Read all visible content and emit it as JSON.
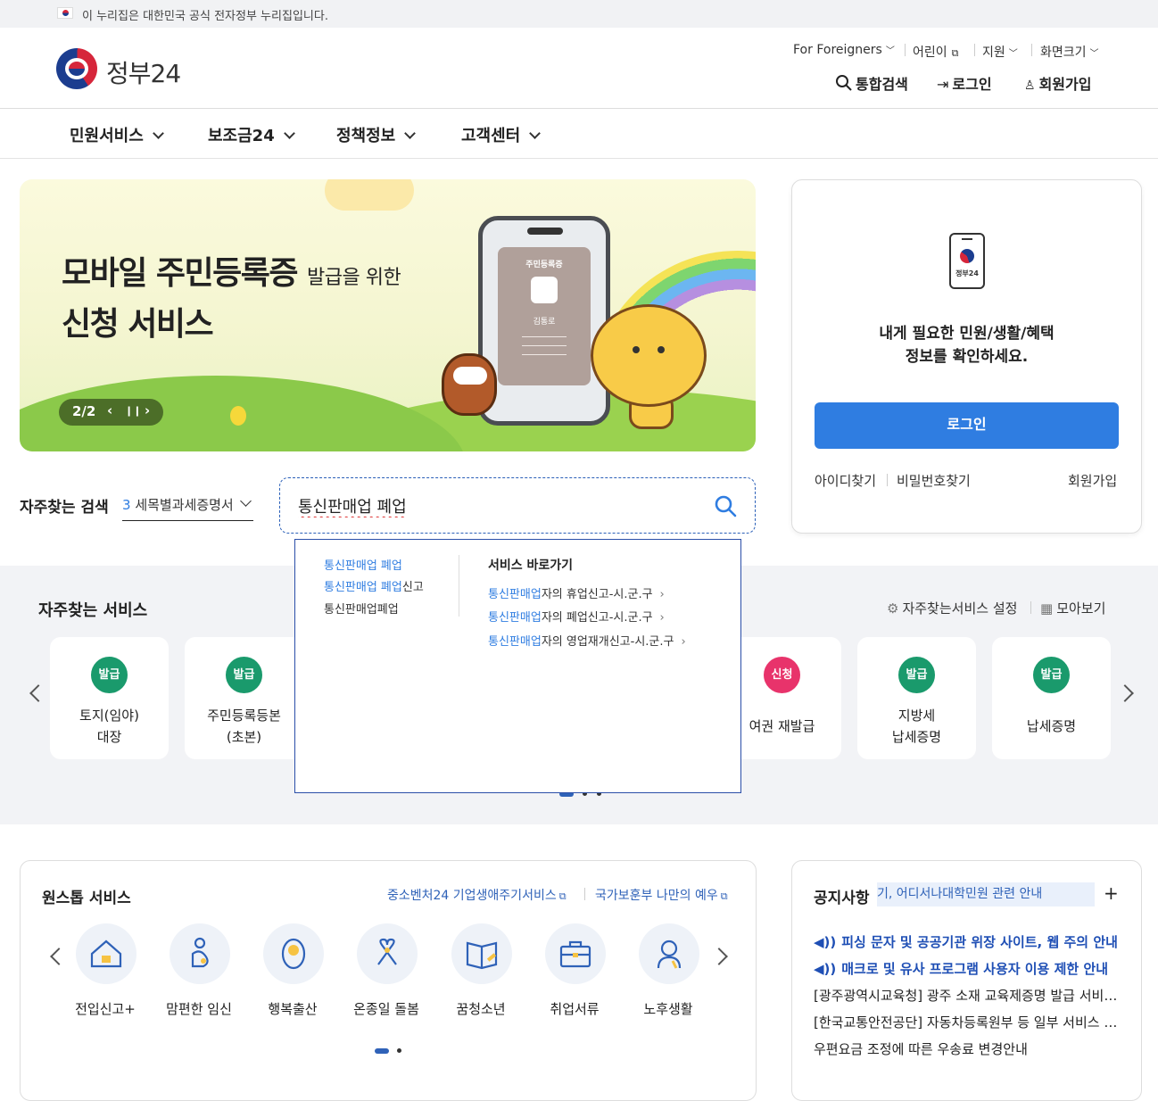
{
  "gov_banner": {
    "text": "이 누리집은 대한민국 공식 전자정부 누리집입니다."
  },
  "header": {
    "logo_text": "정부24",
    "util": [
      "For Foreigners",
      "어린이",
      "지원",
      "화면크기"
    ],
    "buttons": {
      "search": "통합검색",
      "login": "로그인",
      "signup": "회원가입"
    }
  },
  "gnb": [
    "민원서비스",
    "보조금24",
    "정책정보",
    "고객센터"
  ],
  "banner": {
    "title_line1": "모바일 주민등록증",
    "title_small": "발급을 위한",
    "title_line2": "신청 서비스",
    "card_label": "주민등록증",
    "card_name": "김통로",
    "counter": "2/2"
  },
  "login_card": {
    "phone_label": "정부24",
    "message_line1": "내게 필요한 민원/생활/혜택",
    "message_line2": "정보를 확인하세요.",
    "login_button": "로그인",
    "links": {
      "find_id": "아이디찾기",
      "find_pw": "비밀번호찾기",
      "signup": "회원가입"
    }
  },
  "search": {
    "label": "자주찾는 검색",
    "select_num": "3",
    "select_text": "세목별과세증명서",
    "query": "통신판매업 폐업"
  },
  "autocomplete": {
    "suggestions": [
      {
        "hl": "통신판매업 폐업",
        "rest": ""
      },
      {
        "hl": "통신판매업 폐업",
        "rest": "신고"
      },
      {
        "hl": "",
        "rest": "통신판매업폐업"
      }
    ],
    "shortcut_title": "서비스 바로가기",
    "shortcuts": [
      {
        "hl": "통신판매업",
        "rest": "자의 휴업신고-시.군.구"
      },
      {
        "hl": "통신판매업",
        "rest": "자의 폐업신고-시.군.구"
      },
      {
        "hl": "통신판매업",
        "rest": "자의 영업재개신고-시.군.구"
      }
    ]
  },
  "frequent_services": {
    "title": "자주찾는 서비스",
    "settings": "자주찾는서비스 설정",
    "view_all": "모아보기",
    "cards": [
      {
        "badge": "발급",
        "color": "#1a9a6c",
        "line1": "토지(임야)",
        "line2": "대장"
      },
      {
        "badge": "발급",
        "color": "#1a9a6c",
        "line1": "주민등록등본",
        "line2": "(초본)"
      },
      {
        "badge": "신청",
        "color": "#e8336b",
        "line1": "여권 재발급",
        "line2": ""
      },
      {
        "badge": "발급",
        "color": "#1a9a6c",
        "line1": "지방세",
        "line2": "납세증명"
      },
      {
        "badge": "발급",
        "color": "#1a9a6c",
        "line1": "납세증명",
        "line2": ""
      }
    ]
  },
  "one_stop": {
    "title": "원스톱 서비스",
    "link1": "중소벤처24 기업생애주기서비스",
    "link2": "국가보훈부 나만의 예우",
    "items": [
      "전입신고+",
      "맘편한 임신",
      "행복출산",
      "온종일 돌봄",
      "꿈청소년",
      "취업서류",
      "노후생활"
    ]
  },
  "notice": {
    "title": "공지사항",
    "ticker": "기, 어디서나대학민원 관련 안내",
    "items": [
      "피싱 문자 및 공공기관 위장 사이트, 웹 주의 안내",
      "매크로 및 유사 프로그램 사용자 이용 제한 안내",
      "[광주광역시교육청] 광주 소재 교육제증명 발급 서비스 중단 안내",
      "[한국교통안전공단] 자동차등록원부 등 일부 서비스 중단 안내",
      "우편요금 조정에 따른 우송료 변경안내"
    ]
  }
}
